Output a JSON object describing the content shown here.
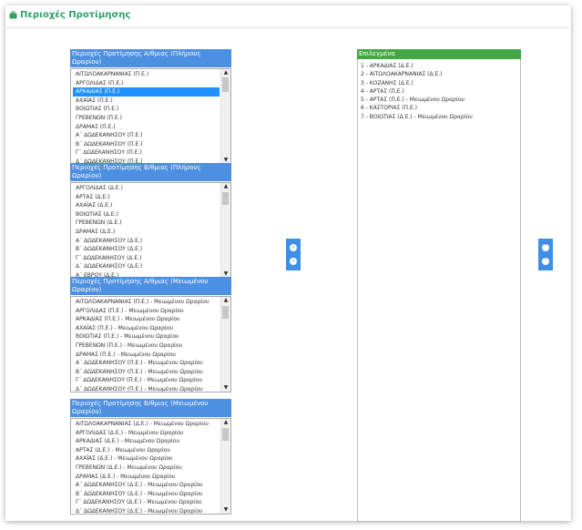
{
  "header": {
    "title": "Περιοχές Προτίμησης"
  },
  "lists": [
    {
      "title": "Περιοχές Προτίμησης Α/θμιας (Πλήρους Ωραρίου)",
      "items": [
        "ΑΙΤΩΛΟΑΚΑΡΝΑΝΙΑΣ (Π.Ε.)",
        "ΑΡΓΟΛΙΔΑΣ (Π.Ε.)",
        "ΑΡΚΑΔΙΑΣ (Π.Ε.)",
        "ΑΧΑΪΑΣ (Π.Ε.)",
        "ΒΟΙΩΤΙΑΣ (Π.Ε.)",
        "ΓΡΕΒΕΝΩΝ (Π.Ε.)",
        "ΔΡΑΜΑΣ (Π.Ε.)",
        "Α΄ ΔΩΔΕΚΑΝΗΣΟΥ (Π.Ε.)",
        "Β΄ ΔΩΔΕΚΑΝΗΣΟΥ (Π.Ε.)",
        "Γ΄ ΔΩΔΕΚΑΝΗΣΟΥ (Π.Ε.)",
        "Δ΄ ΔΩΔΕΚΑΝΗΣΟΥ (Π.Ε.)"
      ],
      "selected_index": 2
    },
    {
      "title": "Περιοχές Προτίμησης Β/θμιας (Πλήρους Ωραρίου)",
      "items": [
        "ΑΡΓΟΛΙΔΑΣ (Δ.Ε.)",
        "ΑΡΤΑΣ (Δ.Ε.)",
        "ΑΧΑΪΑΣ (Δ.Ε.)",
        "ΒΟΙΩΤΙΑΣ (Δ.Ε.)",
        "ΓΡΕΒΕΝΩΝ (Δ.Ε.)",
        "ΔΡΑΜΑΣ (Δ.Ε.)",
        "Α΄ ΔΩΔΕΚΑΝΗΣΟΥ (Δ.Ε.)",
        "Β΄ ΔΩΔΕΚΑΝΗΣΟΥ (Δ.Ε.)",
        "Γ΄ ΔΩΔΕΚΑΝΗΣΟΥ (Δ.Ε.)",
        "Δ΄ ΔΩΔΕΚΑΝΗΣΟΥ (Δ.Ε.)",
        "Α΄ ΕΒΡΟΥ (Δ.Ε.)"
      ],
      "selected_index": -1
    },
    {
      "title": "Περιοχές Προτίμησης Α/θμιας (Μειωμένου Ωραρίου)",
      "items": [
        "ΑΙΤΩΛΟΑΚΑΡΝΑΝΙΑΣ (Π.Ε.) - Μειωμένου Ωραρίου",
        "ΑΡΓΟΛΙΔΑΣ (Π.Ε.) - Μειωμένου Ωραρίου",
        "ΑΡΚΑΔΙΑΣ (Π.Ε.) - Μειωμένου Ωραρίου",
        "ΑΧΑΪΑΣ (Π.Ε.) - Μειωμένου Ωραρίου",
        "ΒΟΙΩΤΙΑΣ (Π.Ε.) - Μειωμένου Ωραρίου",
        "ΓΡΕΒΕΝΩΝ (Π.Ε.) - Μειωμένου Ωραρίου",
        "ΔΡΑΜΑΣ (Π.Ε.) - Μειωμένου Ωραρίου",
        "Α΄ ΔΩΔΕΚΑΝΗΣΟΥ (Π.Ε.) - Μειωμένου Ωραρίου",
        "Β΄ ΔΩΔΕΚΑΝΗΣΟΥ (Π.Ε.) - Μειωμένου Ωραρίου",
        "Γ΄ ΔΩΔΕΚΑΝΗΣΟΥ (Π.Ε.) - Μειωμένου Ωραρίου",
        "Δ΄ ΔΩΔΕΚΑΝΗΣΟΥ (Π.Ε.) - Μειωμένου Ωραρίου"
      ],
      "selected_index": -1
    },
    {
      "title": "Περιοχές Προτίμησης Β/θμιας (Μειωμένου Ωραρίου)",
      "items": [
        "ΑΙΤΩΛΟΑΚΑΡΝΑΝΙΑΣ (Δ.Ε.) - Μειωμένου Ωραρίου",
        "ΑΡΓΟΛΙΔΑΣ (Δ.Ε.) - Μειωμένου Ωραρίου",
        "ΑΡΚΑΔΙΑΣ (Δ.Ε.) - Μειωμένου Ωραρίου",
        "ΑΡΤΑΣ (Δ.Ε.) - Μειωμένου Ωραρίου",
        "ΑΧΑΪΑΣ (Δ.Ε.) - Μειωμένου Ωραρίου",
        "ΓΡΕΒΕΝΩΝ (Δ.Ε.) - Μειωμένου Ωραρίου",
        "ΔΡΑΜΑΣ (Δ.Ε.) - Μειωμένου Ωραρίου",
        "Α΄ ΔΩΔΕΚΑΝΗΣΟΥ (Δ.Ε.) - Μειωμένου Ωραρίου",
        "Β΄ ΔΩΔΕΚΑΝΗΣΟΥ (Δ.Ε.) - Μειωμένου Ωραρίου",
        "Γ΄ ΔΩΔΕΚΑΝΗΣΟΥ (Δ.Ε.) - Μειωμένου Ωραρίου",
        "Δ΄ ΔΩΔΕΚΑΝΗΣΟΥ (Δ.Ε.) - Μειωμένου Ωραρίου"
      ],
      "selected_index": -1
    }
  ],
  "selected": {
    "title": "Επιλεγμένα",
    "items": [
      "1 - ΑΡΚΑΔΙΑΣ (Δ.Ε.)",
      "2 - ΑΙΤΩΛΟΑΚΑΡΝΑΝΙΑΣ (Δ.Ε.)",
      "3 - ΚΟΖΑΝΗΣ (Δ.Ε.)",
      "4 - ΑΡΤΑΣ (Π.Ε.)",
      "5 - ΑΡΤΑΣ (Π.Ε.) - Μειωμένου Ωραρίου",
      "6 - ΚΑΣΤΟΡΙΑΣ (Π.Ε.)",
      "7 - ΒΟΙΩΤΙΑΣ (Δ.Ε.) - Μειωμένου Ωραρίου"
    ]
  },
  "buttons": {
    "add_glyph": "›",
    "remove_glyph": "‹",
    "move_up_glyph": "˄",
    "move_down_glyph": "˅",
    "scroll_up_glyph": "▲",
    "scroll_down_glyph": "▼"
  },
  "colors": {
    "accent": "#2e9e6a",
    "list_header": "#4d8fe0",
    "selected_header": "#43a843",
    "button": "#3f8fe6"
  },
  "icons": {
    "header_icon": "briefcase-icon"
  }
}
